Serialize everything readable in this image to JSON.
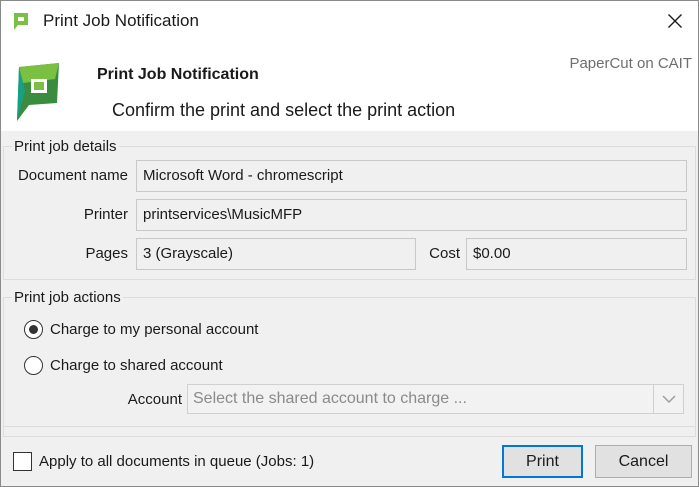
{
  "window": {
    "title": "Print Job Notification"
  },
  "header": {
    "title": "Print Job Notification",
    "subtitle": "Confirm the print and select the print action",
    "brand": "PaperCut on CAIT"
  },
  "details": {
    "group_title": "Print job details",
    "document_label": "Document name",
    "document_value": "Microsoft Word - chromescript",
    "printer_label": "Printer",
    "printer_value": "printservices\\MusicMFP",
    "pages_label": "Pages",
    "pages_value": "3   (Grayscale)",
    "cost_label": "Cost",
    "cost_value": "$0.00"
  },
  "actions": {
    "group_title": "Print job actions",
    "personal_label": "Charge to my personal account",
    "shared_label": "Charge to shared account",
    "selected": "personal",
    "account_label": "Account",
    "account_placeholder": "Select the shared account to charge ..."
  },
  "footer": {
    "apply_all_label": "Apply to all documents in queue (Jobs: 1)",
    "apply_all_checked": false,
    "print_label": "Print",
    "cancel_label": "Cancel"
  },
  "colors": {
    "logo_green": "#7ac143",
    "logo_dark_green": "#3a8d3f",
    "logo_teal": "#16a086",
    "primary_border": "#0078d7"
  }
}
